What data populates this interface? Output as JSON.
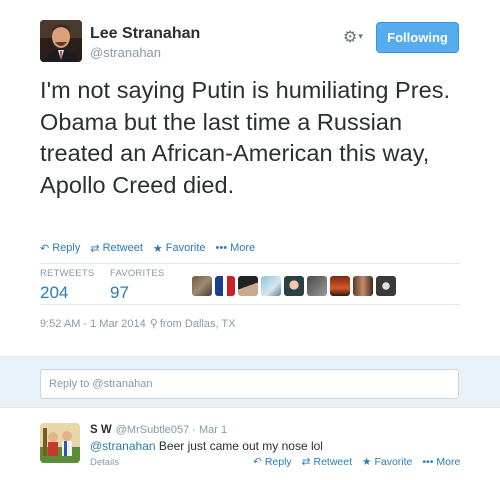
{
  "tweet": {
    "author_name": "Lee Stranahan",
    "author_handle": "@stranahan",
    "follow_label": "Following",
    "text": "I'm not saying Putin is humiliating Pres. Obama but the last time a Russian treated an African-American this way, Apollo Creed died.",
    "actions": {
      "reply": "Reply",
      "retweet": "Retweet",
      "favorite": "Favorite",
      "more": "More"
    },
    "stats": {
      "retweets_label": "RETWEETS",
      "retweets_value": "204",
      "favorites_label": "FAVORITES",
      "favorites_value": "97"
    },
    "timestamp": "9:52 AM - 1 Mar 2014",
    "location": "from Dallas, TX"
  },
  "reply_box": {
    "placeholder": "Reply to @stranahan"
  },
  "reply": {
    "author_name": "S W",
    "author_handle": "@MrSubtle057",
    "separator": "·",
    "time": "Mar 1",
    "mention": "@stranahan",
    "text": " Beer just came out my nose lol",
    "details": "Details",
    "actions": {
      "reply": "Reply",
      "retweet": "Retweet",
      "favorite": "Favorite",
      "more": "More"
    }
  },
  "icons": {
    "reply": "reply-icon",
    "retweet": "retweet-icon",
    "favorite": "star-icon",
    "more": "more-dots-icon",
    "gear": "gear-icon",
    "location": "location-pin-icon"
  },
  "colors": {
    "link_blue": "#2b7bb9",
    "follow_button": "#55acee",
    "muted_gray": "#8899a6",
    "reply_area_bg": "#e8f1f8"
  }
}
